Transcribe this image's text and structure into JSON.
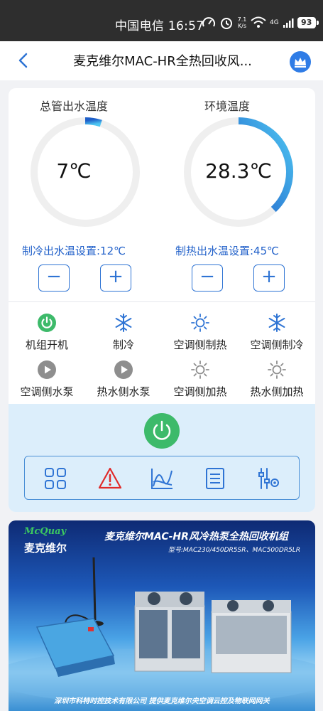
{
  "status_bar": {
    "carrier_time": "中国电信 16:57",
    "net_speed_value": "7.1",
    "net_speed_unit": "K/s",
    "network": "4G",
    "battery": "93"
  },
  "header": {
    "title": "麦克维尔MAC-HR全热回收风...",
    "back_icon": "back-chevron-icon",
    "vip_icon": "crown-icon"
  },
  "gauges": [
    {
      "title": "总管出水温度",
      "value": "7℃",
      "fill": 0.05,
      "setpoint": "制冷出水温设置:12℃",
      "minus": "−",
      "plus": "+"
    },
    {
      "title": "环境温度",
      "value": "28.3℃",
      "fill": 0.38,
      "setpoint": "制热出水温设置:45℃",
      "minus": "−",
      "plus": "+"
    }
  ],
  "status_items": [
    {
      "label": "机组开机",
      "icon": "power-on-icon"
    },
    {
      "label": "制冷",
      "icon": "snowflake-icon"
    },
    {
      "label": "空调侧制热",
      "icon": "sun-icon"
    },
    {
      "label": "空调侧制冷",
      "icon": "snowflake-icon"
    },
    {
      "label": "空调侧水泵",
      "icon": "pump-icon"
    },
    {
      "label": "热水侧水泵",
      "icon": "pump-icon"
    },
    {
      "label": "空调侧加热",
      "icon": "heater-icon"
    },
    {
      "label": "热水侧加热",
      "icon": "heater-icon"
    }
  ],
  "toolbar": [
    "grid-icon",
    "alarm-icon",
    "chart-icon",
    "list-icon",
    "settings-icon"
  ],
  "colors": {
    "accent": "#2f74d4",
    "green": "#3dba6a",
    "arc_start": "#1f5fc9",
    "arc_end": "#4fc7f2",
    "track": "#efefef"
  },
  "banner": {
    "brand_en": "McQuay",
    "brand_cn": "麦克维尔",
    "title": "麦克维尔MAC-HR风冷热泵全热回收机组",
    "model": "型号:MAC230/450DR5SR、MAC500DR5LR",
    "footer": "深圳市科特时控技术有限公司  提供麦克维尔央空调云控及物联网网关"
  }
}
